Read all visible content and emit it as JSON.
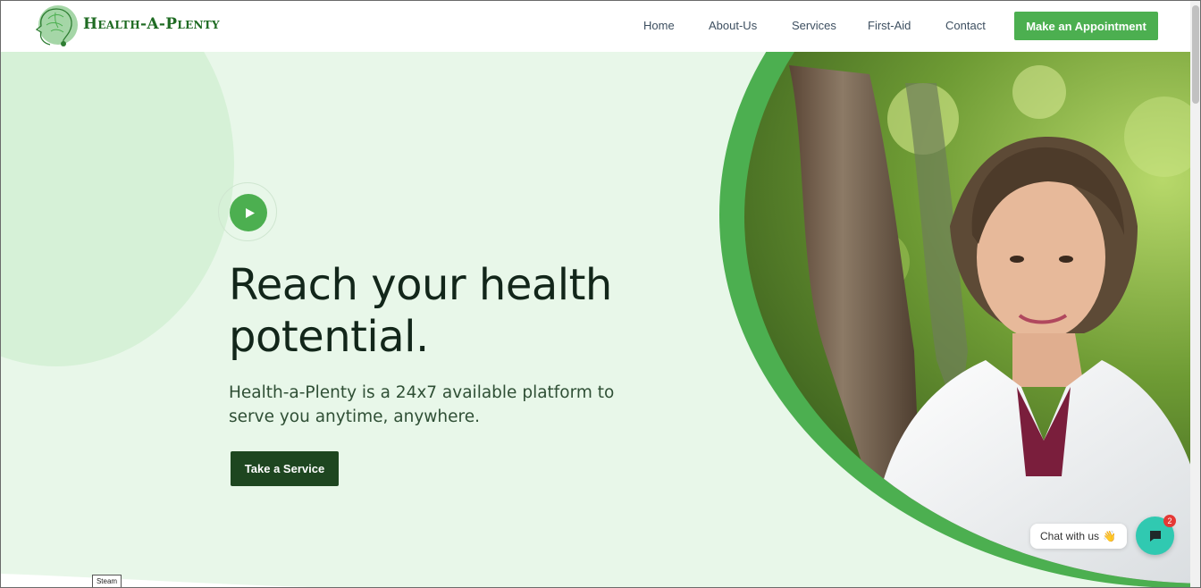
{
  "header": {
    "brand": "Health-A-Plenty",
    "nav": [
      "Home",
      "About-Us",
      "Services",
      "First-Aid",
      "Contact"
    ],
    "cta": "Make an Appointment"
  },
  "hero": {
    "headline": "Reach your health potential.",
    "subtitle": "Health-a-Plenty is a 24x7 available platform to serve you anytime, anywhere.",
    "button": "Take a Service"
  },
  "chat": {
    "label": "Chat with us",
    "badge_count": "2"
  },
  "taskbar_tag": "Steam",
  "icons": {
    "logo": "head-brain-logo-icon",
    "play": "play-icon",
    "chat": "chat-bubble-icon",
    "wave": "waving-hand-icon"
  },
  "colors": {
    "brand_green": "#4caf50",
    "dark_green": "#1e4620",
    "hero_bg": "#e8f7e9",
    "chat_teal": "#30c9b1"
  }
}
